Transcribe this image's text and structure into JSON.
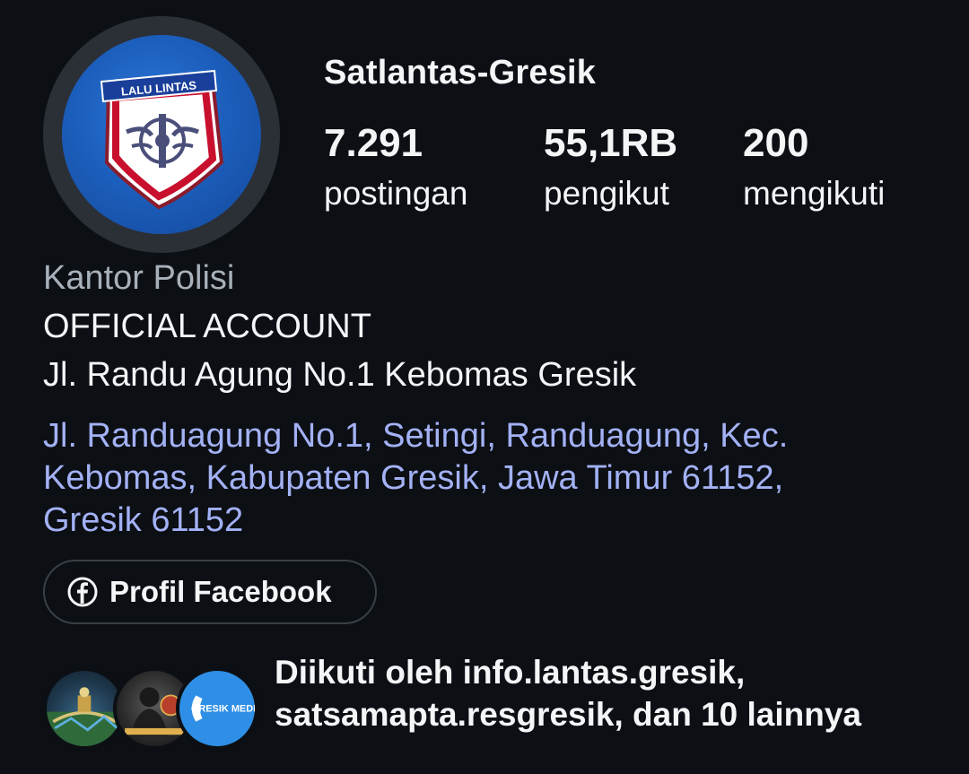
{
  "profile": {
    "username": "Satlantas-Gresik",
    "avatar_text": "LALU LINTAS",
    "stats": [
      {
        "value": "7.291",
        "label": "postingan"
      },
      {
        "value": "55,1RB",
        "label": "pengikut"
      },
      {
        "value": "200",
        "label": "mengikuti"
      }
    ]
  },
  "bio": {
    "category": "Kantor Polisi",
    "lines": [
      "OFFICIAL ACCOUNT",
      "Jl. Randu Agung No.1 Kebomas Gresik"
    ],
    "address": "Jl. Randuagung No.1, Setingi, Randuagung, Kec. Kebomas, Kabupaten Gresik, Jawa Timur 61152, Gresik 61152"
  },
  "facebook_button": {
    "label": "Profil Facebook",
    "icon": "facebook-icon"
  },
  "followed_by": {
    "text": "Diikuti oleh info.lantas.gresik, satsamapta.resgresik, dan 10 lainnya",
    "avatar3_text": "GRESIK MEDIA"
  },
  "colors": {
    "background": "#0c0f14",
    "text": "#f3f5f7",
    "muted": "#a8b0b9",
    "link": "#a3b1f5"
  }
}
